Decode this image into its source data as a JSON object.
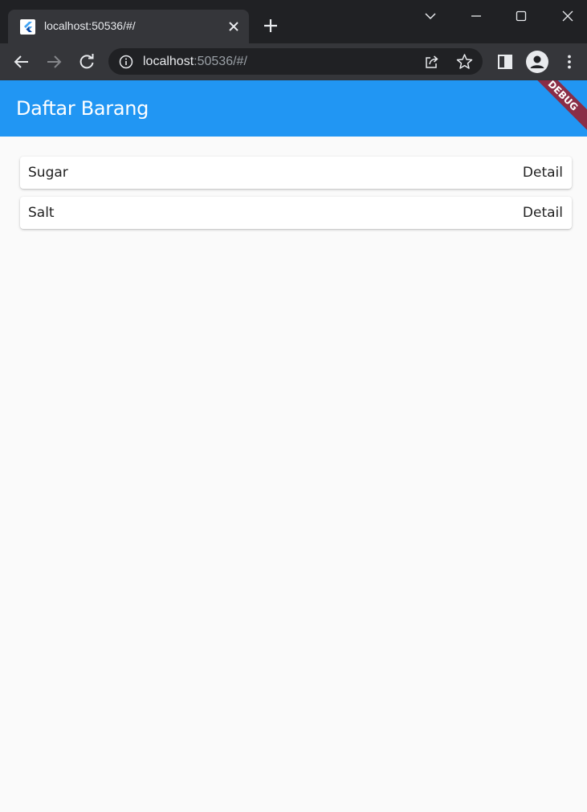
{
  "browser": {
    "tab_title": "localhost:50536/#/",
    "url_host": "localhost",
    "url_rest": ":50536/#/"
  },
  "app": {
    "title": "Daftar Barang",
    "debug_label": "DEBUG",
    "primary_color": "#2196f3",
    "items": [
      {
        "name": "Sugar",
        "action": "Detail"
      },
      {
        "name": "Salt",
        "action": "Detail"
      }
    ]
  }
}
